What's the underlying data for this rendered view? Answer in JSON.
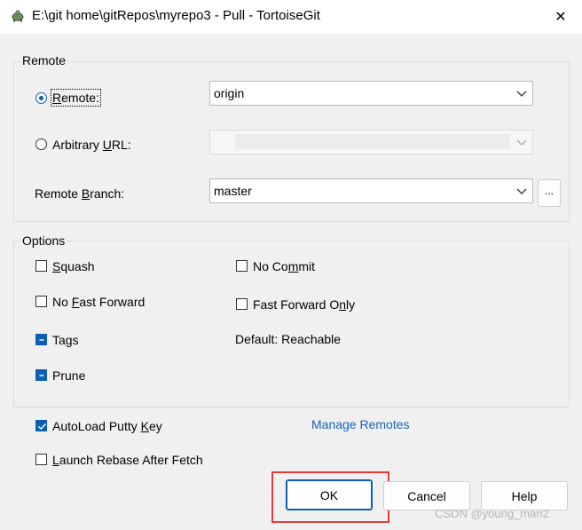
{
  "window": {
    "title": "E:\\git home\\gitRepos\\myrepo3 - Pull - TortoiseGit",
    "close_glyph": "✕"
  },
  "remote_group": {
    "label": "Remote",
    "remote_radio": {
      "label_pre": "",
      "label_mnemonic": "R",
      "label_post": "emote:",
      "checked": true
    },
    "remote_value": "origin",
    "arbitrary_radio": {
      "label_pre": "Arbitrary ",
      "label_mnemonic": "U",
      "label_post": "RL:",
      "checked": false
    },
    "arbitrary_value": "",
    "branch_label": {
      "pre": "Remote ",
      "mnemonic": "B",
      "post": "ranch:"
    },
    "branch_value": "master",
    "browse_label": "..."
  },
  "options_group": {
    "label": "Options",
    "squash": {
      "pre": "",
      "mnemonic": "S",
      "post": "quash",
      "checked": false
    },
    "no_commit": {
      "pre": "No Co",
      "mnemonic": "m",
      "post": "mit",
      "checked": false
    },
    "no_ff": {
      "pre": "No ",
      "mnemonic": "F",
      "post": "ast Forward",
      "checked": false
    },
    "ff_only": {
      "pre": "Fast Forward O",
      "mnemonic": "n",
      "post": "ly",
      "checked": false
    },
    "tags": {
      "label": "Tags",
      "state": "indeterminate"
    },
    "default_text": "Default: Reachable",
    "prune": {
      "label": "Prune",
      "state": "indeterminate"
    }
  },
  "bottom": {
    "autoload": {
      "pre": "AutoLoad Putty ",
      "mnemonic": "K",
      "post": "ey",
      "checked": true
    },
    "manage_remotes": "Manage Remotes",
    "launch_rebase": {
      "pre": "",
      "mnemonic": "L",
      "post": "aunch Rebase After Fetch",
      "checked": false
    }
  },
  "buttons": {
    "ok": "OK",
    "cancel": "Cancel",
    "help": "Help"
  },
  "watermark": "CSDN @young_man2",
  "colors": {
    "accent": "#0a5fb4",
    "highlight": "#e23b3b",
    "link": "#1a63b8"
  }
}
